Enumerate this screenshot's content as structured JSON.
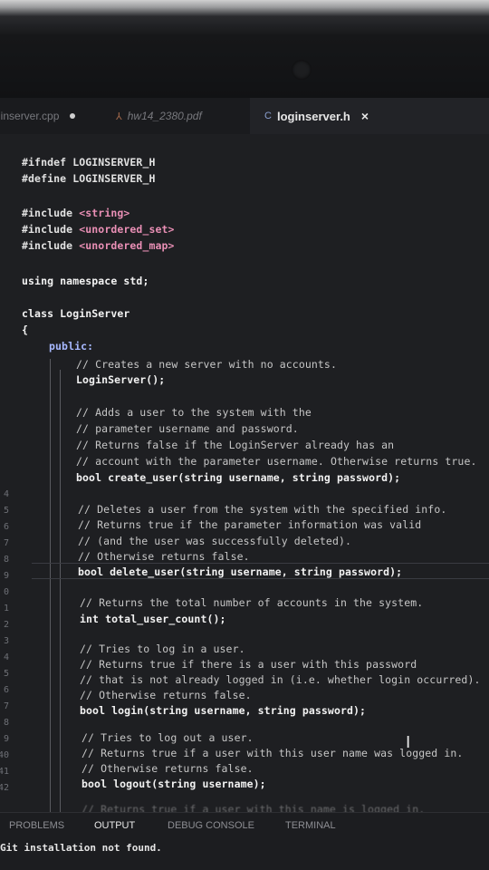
{
  "tabs": [
    {
      "label": "ginserver.cpp",
      "modified": true
    },
    {
      "label": "hw14_2380.pdf",
      "icon": "pdf-icon"
    },
    {
      "label": "loginserver.h",
      "icon": "c-header-icon",
      "close": "×"
    }
  ],
  "code": [
    "#ifndef LOGINSERVER_H",
    "#define LOGINSERVER_H",
    "",
    "#include <string>",
    "#include <unordered_set>",
    "#include <unordered_map>",
    "",
    "using namespace std;",
    "",
    "class LoginServer",
    "{",
    "public:",
    "// Creates a new server with no accounts.",
    "LoginServer();",
    "",
    "// Adds a user to the system with the",
    "// parameter username and password.",
    "// Returns false if the LoginServer already has an",
    "// account with the parameter username. Otherwise returns true.",
    "bool create_user(string username, string password);",
    "",
    "// Deletes a user from the system with the specified info.",
    "// Returns true if the parameter information was valid",
    "// (and the user was successfully deleted).",
    "// Otherwise returns false.",
    "bool delete_user(string username, string password);",
    "",
    "// Returns the total number of accounts in the system.",
    "int total_user_count();",
    "",
    "// Tries to log in a user.",
    "// Returns true if there is a user with this password",
    "// that is not already logged in (i.e. whether login occurred).",
    "// Otherwise returns false.",
    "bool login(string username, string password);",
    "",
    "// Tries to log out a user.",
    "// Returns true if a user with this user name was logged in.",
    "// Otherwise returns false.",
    "bool logout(string username);",
    "",
    "// Returns true if a user with this name is logged in."
  ],
  "line_numbers": [
    "4",
    "5",
    "6",
    "7",
    "8",
    "9",
    "0",
    "1",
    "2",
    "3",
    "4",
    "5",
    "6",
    "7",
    "8",
    "9",
    "40",
    "41",
    "42"
  ],
  "panel": {
    "tabs": [
      "PROBLEMS",
      "OUTPUT",
      "DEBUG CONSOLE",
      "TERMINAL"
    ],
    "active": "OUTPUT",
    "output": "Git installation not found."
  },
  "colors": {
    "background": "#1e1f22",
    "string": "#e98fb5",
    "include": "#e2b3d6"
  }
}
